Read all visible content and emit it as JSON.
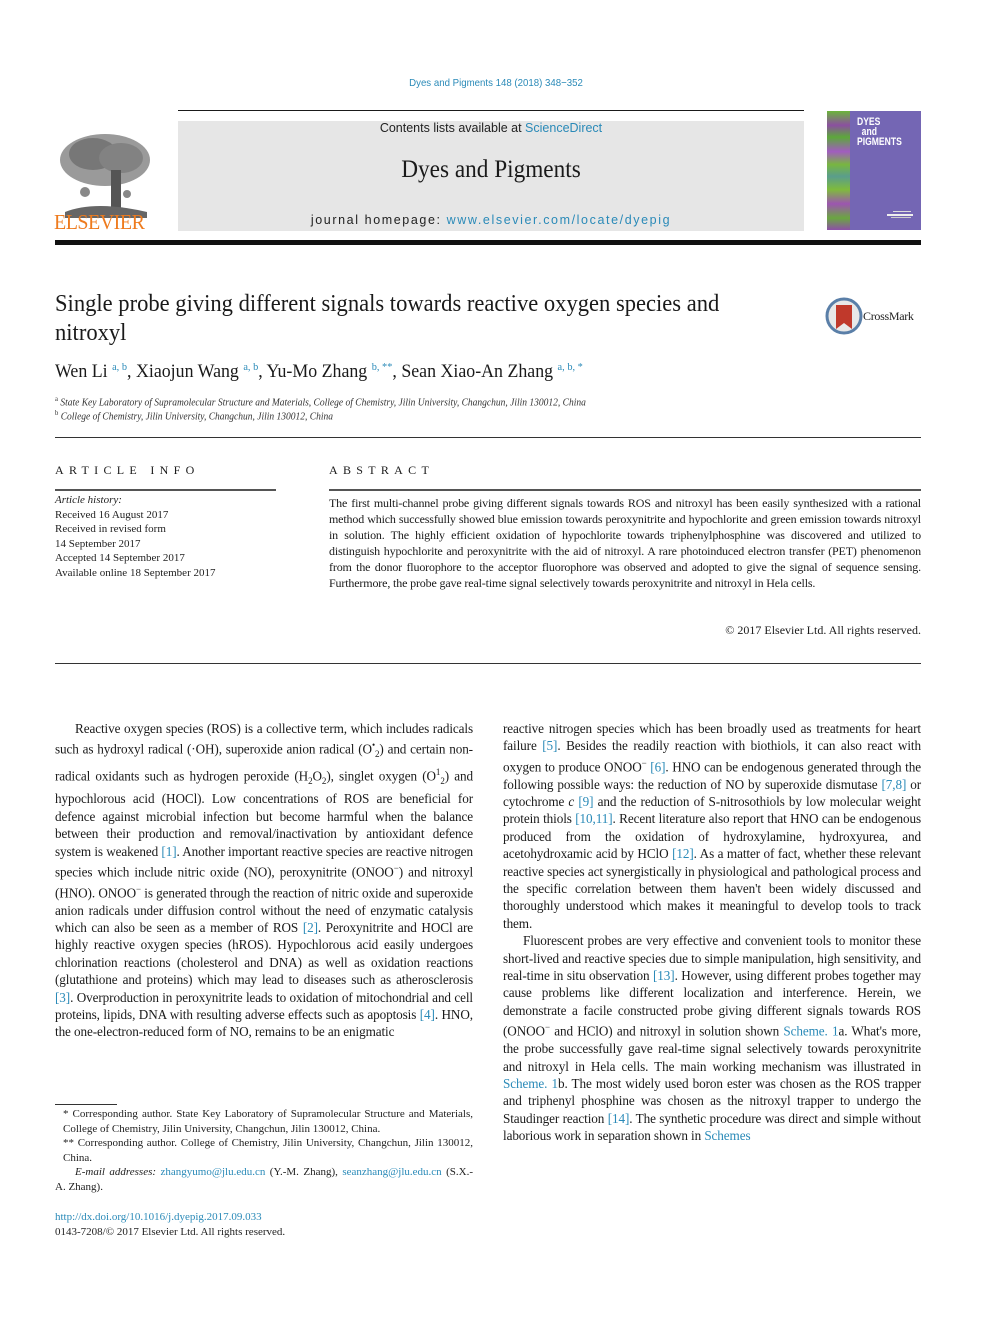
{
  "header": {
    "journal_ref": "Dyes and Pigments 148 (2018) 348−352",
    "contents_prefix": "Contents lists available at ",
    "contents_link": "ScienceDirect",
    "journal_title": "Dyes and Pigments",
    "homepage_prefix": "journal homepage: ",
    "homepage_link": "www.elsevier.com/locate/dyepig",
    "publisher_logo_text": "ELSEVIER",
    "cover_title_lines": [
      "DYES",
      "and",
      "PIGMENTS"
    ]
  },
  "article": {
    "title": "Single probe giving different signals towards reactive oxygen species and nitroxyl",
    "crossmark_label": "CrossMark",
    "authors": [
      {
        "name": "Wen Li",
        "marks": "a, b"
      },
      {
        "name": "Xiaojun Wang",
        "marks": "a, b"
      },
      {
        "name": "Yu-Mo Zhang",
        "marks": "b, **"
      },
      {
        "name": "Sean Xiao-An Zhang",
        "marks": "a, b, *"
      }
    ],
    "affiliations": [
      {
        "mark": "a",
        "text": "State Key Laboratory of Supramolecular Structure and Materials, College of Chemistry, Jilin University, Changchun, Jilin 130012, China"
      },
      {
        "mark": "b",
        "text": "College of Chemistry, Jilin University, Changchun, Jilin 130012, China"
      }
    ]
  },
  "article_info": {
    "heading": "ARTICLE INFO",
    "history_label": "Article history:",
    "history": [
      "Received 16 August 2017",
      "Received in revised form",
      "14 September 2017",
      "Accepted 14 September 2017",
      "Available online 18 September 2017"
    ]
  },
  "abstract": {
    "heading": "ABSTRACT",
    "text": "The first multi-channel probe giving different signals towards ROS and nitroxyl has been easily syn­thesized with a rational method which successfully showed blue emission towards peroxynitrite and hypochlorite and green emission towards nitroxyl in solution. The highly efficient oxidation of hypo­chlorite towards triphenylphosphine was discovered and utilized to distinguish hypochlorite and per­oxynitrite with the aid of nitroxyl. A rare photoinduced electron transfer (PET) phenomenon from the donor fluorophore to the acceptor fluorophore was observed and adopted to give the signal of sequence sensing. Furthermore, the probe gave real-time signal selectively towards peroxynitrite and nitroxyl in Hela cells.",
    "copyright": "© 2017 Elsevier Ltd. All rights reserved."
  },
  "body": {
    "left": {
      "p1": [
        "Reactive oxygen species (ROS) is a collective term, which in­cludes radicals such as hydroxyl radical (·OH), superoxide anion radical (O",
        "and certain non-radical oxidants such as hydrogen peroxide (H",
        "), singlet oxygen (O",
        ") and hypochlorous acid (HOCl). Low concentrations of ROS are beneficial for defence against mi­crobial infection but become harmful when the balance between their production and removal/inactivation by antioxidant defence system is weakened ",
        ". Another important reactive species are reactive nitrogen species which include nitric oxide (NO), perox­ynitrite (ONOO",
        ") and nitroxyl (HNO). ONOO",
        " is generated through the reaction of nitric oxide and superoxide anion radicals under diffusion control without the need of enzymatic catalysis which can also be seen as a member of ROS ",
        ". Peroxynitrite and HOCl are highly reactive oxygen species (hROS). Hypochlorous acid easily undergoes chlorination reactions (cholesterol and DNA) as well as oxidation reactions (glutathione and proteins) which may lead to diseases such as atherosclerosis ",
        ". Overproduction in peroxyni­trite leads to oxidation of mitochondrial and cell proteins, lipids, DNA with resulting adverse effects such as apoptosis ",
        ". HNO, the one-electron-reduced form of NO, remains to be an enigmatic"
      ],
      "refs": [
        "[1]",
        "[2]",
        "[3]",
        "[4]"
      ]
    },
    "right": {
      "p1": [
        "reactive nitrogen species which has been broadly used as treat­ments for heart failure ",
        ". Besides the readily reaction with bio­thiols, it can also react with oxygen to produce ONOO",
        ". HNO can be endogenous generated through the following possible ways: the reduction of NO by superoxide dismutase ",
        " or cytochrome ",
        " and the reduction of S-nitrosothiols by low molecular weight protein thiols ",
        ". Recent literature also report that HNO can be endogenous produced from the oxidation of hydroxylamine, hy­droxyurea, and acetohydroxamic acid by HClO ",
        ". As a matter of fact, whether these relevant reactive species act synergistically in physiological and pathological process and the specific correlation between them haven't been widely discussed and thoroughly un­derstood which makes it meaningful to develop tools to track them."
      ],
      "refs1": [
        "[5]",
        "[6]",
        "[7,8]",
        "[9]",
        "[10,11]",
        "[12]"
      ],
      "italic_c": "c",
      "p2": [
        "Fluorescent probes are very effective and convenient tools to monitor these short-lived and reactive species due to simple manipulation, high sensitivity, and real-time in situ observation ",
        ". However, using different probes together may cause problems like different localization and interference. Herein, we demonstrate a facile constructed probe giving different signals towards ROS (ONOO",
        " and HClO) and nitroxyl in solution shown ",
        "a. What's more, the probe successfully gave real-time signal selec­tively towards peroxynitrite and nitroxyl in Hela cells. The main working mechanism was illustrated in ",
        "b. The most widely used boron ester was chosen as the ROS trapper and triphenyl phosphine was chosen as the nitroxyl trapper to undergo the Staudinger reaction ",
        ". The synthetic procedure was direct and simple without laborious work in separation shown in "
      ],
      "refs2": [
        "[13]",
        "Scheme. 1",
        "Scheme. 1",
        "[14]",
        "Schemes"
      ]
    }
  },
  "footnotes": {
    "star1": "* Corresponding author. State Key Laboratory of Supramolecular Structure and Materials, College of Chemistry, Jilin University, Changchun, Jilin 130012, China.",
    "star2": "** Corresponding author. College of Chemistry, Jilin University, Changchun, Jilin 130012, China.",
    "email_label": "E-mail addresses:",
    "email1": "zhangyumo@jlu.edu.cn",
    "email1_owner": " (Y.-M. Zhang), ",
    "email2": "seanzhang@jlu.edu.cn",
    "email2_owner": " (S.X.-A. Zhang).",
    "doi": "http://dx.doi.org/10.1016/j.dyepig.2017.09.033",
    "issn": "0143-7208/© 2017 Elsevier Ltd. All rights reserved."
  },
  "colors": {
    "link": "#2a8ab8",
    "elsevier_orange": "#ee7b1e",
    "banner_gray": "#e6e6e6",
    "cover_purple": "#7466b4"
  }
}
